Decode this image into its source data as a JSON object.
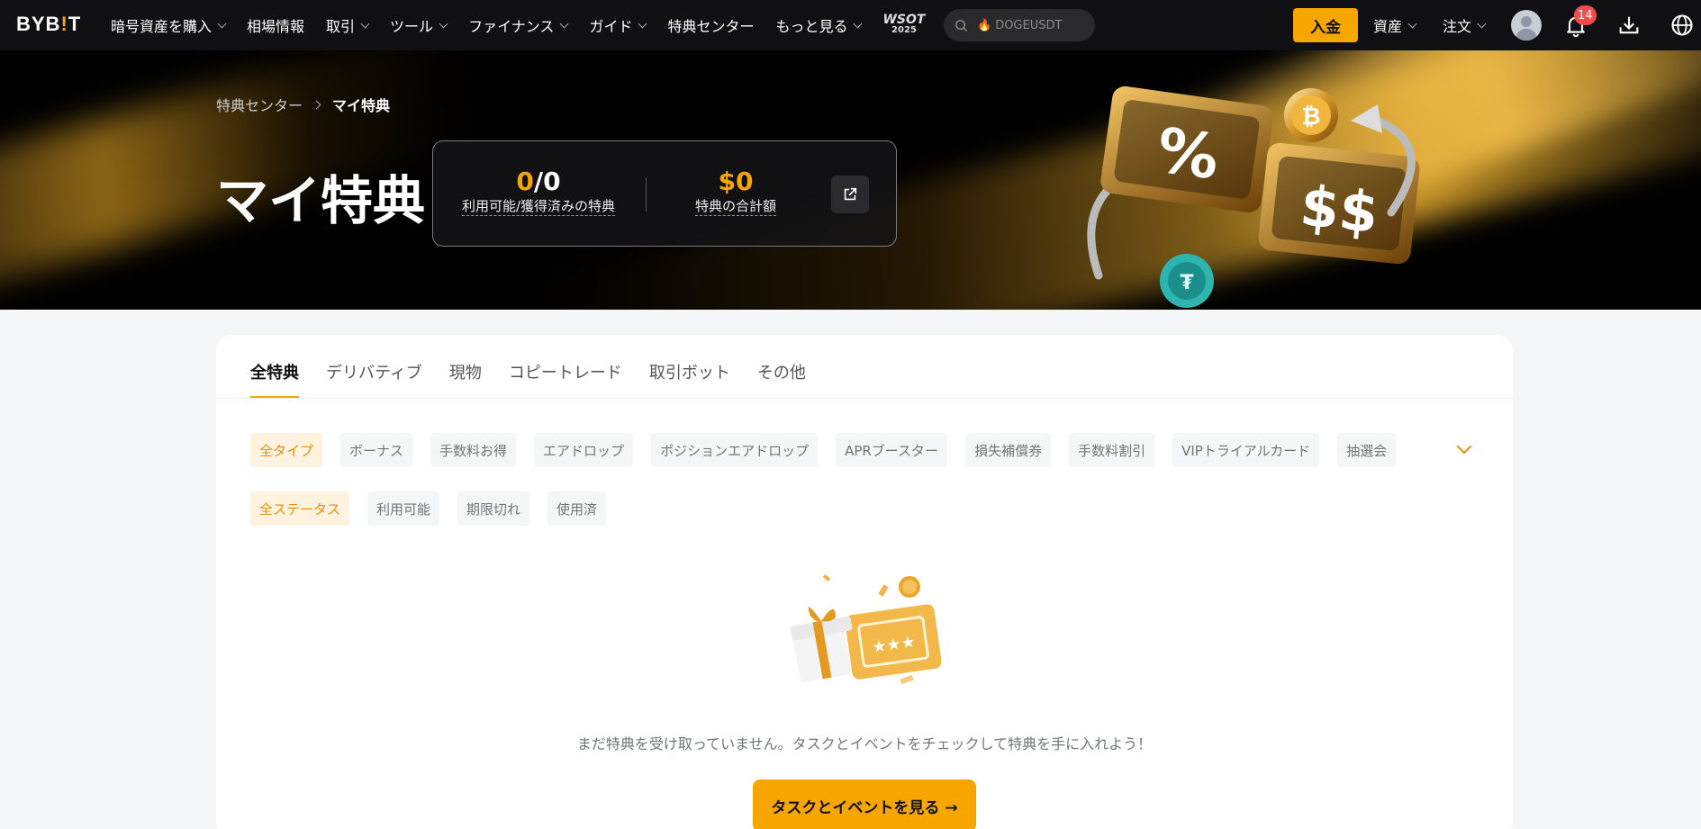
{
  "nav": {
    "logo": "BYB",
    "logo_bang": "!",
    "logo_end": "T",
    "items": [
      {
        "label": "暗号資産を購入",
        "chevron": true
      },
      {
        "label": "相場情報",
        "chevron": false
      },
      {
        "label": "取引",
        "chevron": true
      },
      {
        "label": "ツール",
        "chevron": true
      },
      {
        "label": "ファイナンス",
        "chevron": true
      },
      {
        "label": "ガイド",
        "chevron": true
      },
      {
        "label": "特典センター",
        "chevron": false
      },
      {
        "label": "もっと見る",
        "chevron": true
      }
    ],
    "wsot": "WSOT",
    "wsot_year": "2025",
    "search_text": "DOGEUSDT",
    "deposit": "入金",
    "assets": "資産",
    "orders": "注文",
    "notification_count": "14"
  },
  "hero": {
    "breadcrumb_parent": "特典センター",
    "breadcrumb_current": "マイ特典",
    "title": "マイ特典",
    "available": "0",
    "slash": "/",
    "obtained": "0",
    "count_label": "利用可能/獲得済みの特典",
    "total_value": "$0",
    "total_label": "特典の合計額",
    "art_percent": "%",
    "art_dollar": "$$"
  },
  "tabs": [
    "全特典",
    "デリバティブ",
    "現物",
    "コピートレード",
    "取引ボット",
    "その他"
  ],
  "type_filters": [
    "全タイプ",
    "ボーナス",
    "手数料お得",
    "エアドロップ",
    "ポジションエアドロップ",
    "APRブースター",
    "損失補償券",
    "手数料割引",
    "VIPトライアルカード",
    "抽選会"
  ],
  "status_filters": [
    "全ステータス",
    "利用可能",
    "期限切れ",
    "使用済"
  ],
  "empty": {
    "message": "まだ特典を受け取っていません。タスクとイベントをチェックして特典を手に入れよう！",
    "cta": "タスクとイベントを見る →"
  },
  "colors": {
    "accent": "#f7a600",
    "nav_bg": "#101014",
    "badge": "#f14b4b"
  }
}
